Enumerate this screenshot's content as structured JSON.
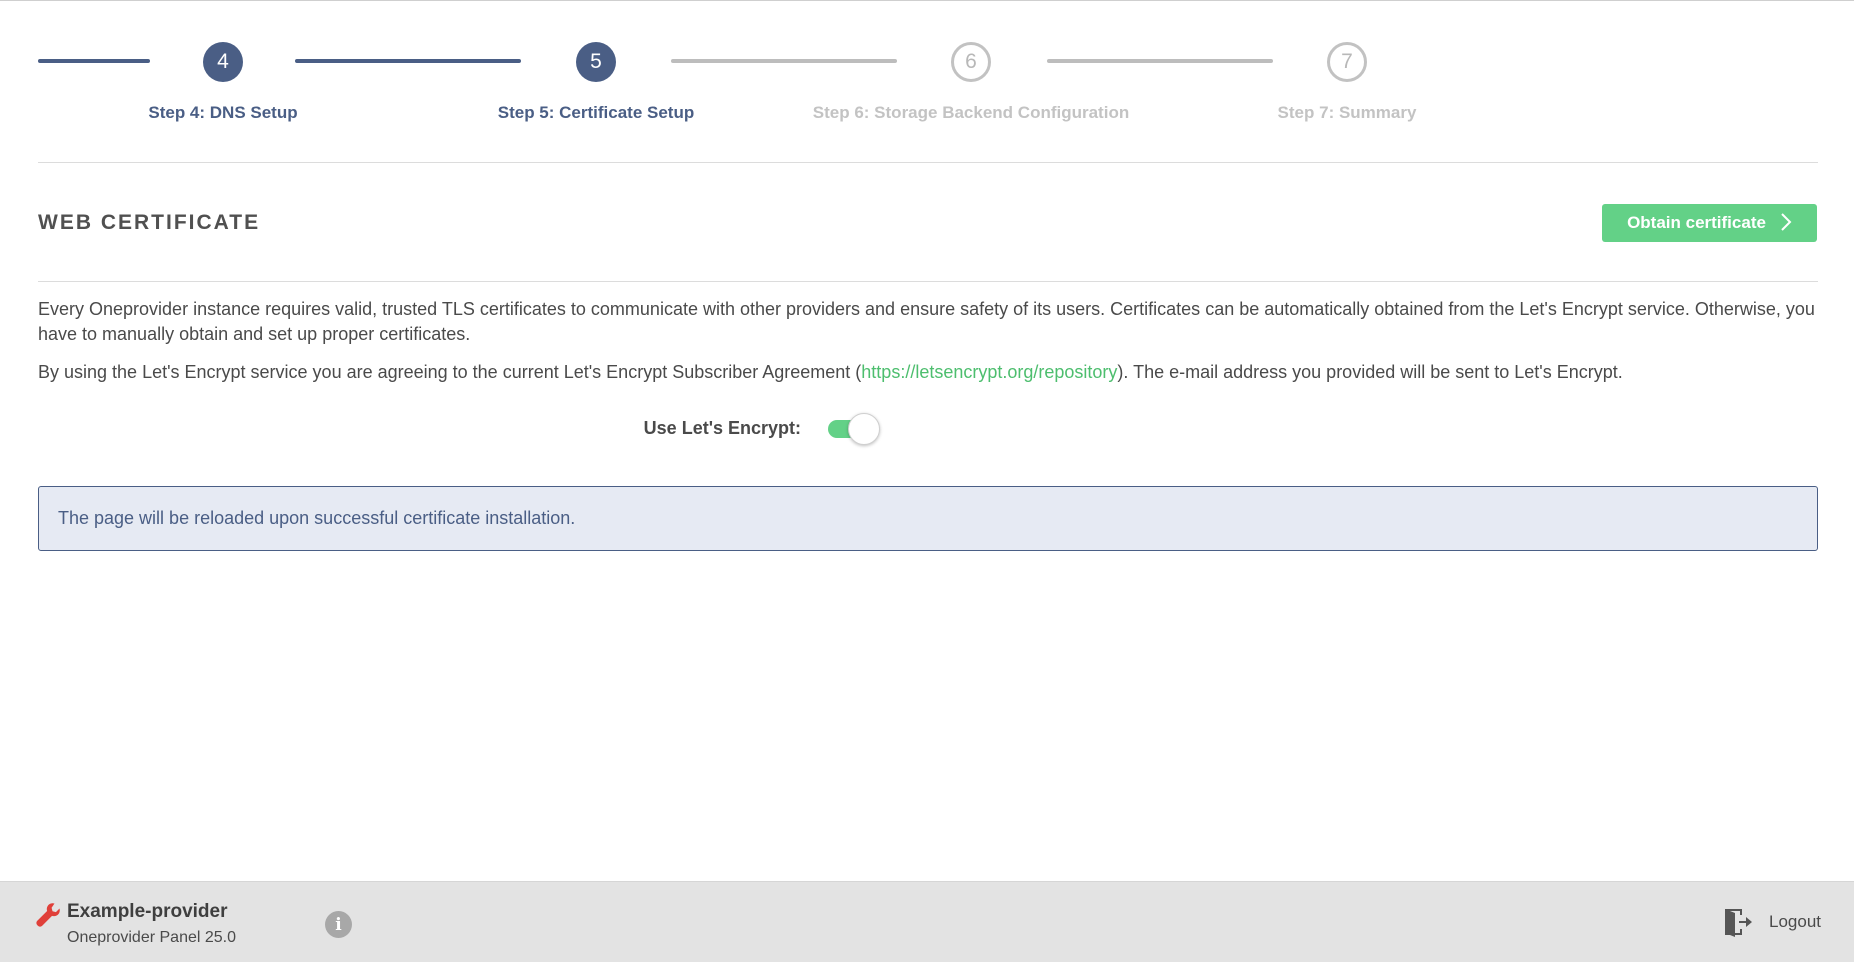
{
  "stepper": {
    "steps": [
      {
        "number": "4",
        "label": "Step 4: DNS Setup",
        "state": "done"
      },
      {
        "number": "5",
        "label": "Step 5: Certificate Setup",
        "state": "current"
      },
      {
        "number": "6",
        "label": "Step 6: Storage Backend Configuration",
        "state": "todo"
      },
      {
        "number": "7",
        "label": "Step 7: Summary",
        "state": "todo"
      }
    ]
  },
  "section": {
    "title": "WEB CERTIFICATE",
    "obtain_button": "Obtain certificate"
  },
  "content": {
    "description": "Every Oneprovider instance requires valid, trusted TLS certificates to communicate with other providers and ensure safety of its users. Certificates can be automatically obtained from the Let's Encrypt service. Otherwise, you have to manually obtain and set up proper certificates.",
    "agreement_before": "By using the Let's Encrypt service you are agreeing to the current Let's Encrypt Subscriber Agreement (",
    "agreement_link": "https://letsencrypt.org/repository",
    "agreement_after": "). The e-mail address you provided will be sent to Let's Encrypt.",
    "toggle_label": "Use Let's Encrypt:",
    "toggle_on": true,
    "info_message": "The page will be reloaded upon successful certificate installation."
  },
  "footer": {
    "provider_name": "Example-provider",
    "panel_version": "Oneprovider Panel 25.0",
    "info_icon_glyph": "i",
    "logout_label": "Logout"
  },
  "colors": {
    "accent_navy": "#4a5e85",
    "accent_green": "#63d187",
    "link_green": "#4dbe6e",
    "wrench_red": "#e0403a"
  },
  "icons": {
    "provider": "wrench-icon",
    "info": "info-icon",
    "logout": "logout-icon",
    "obtain_button": "chevron-right-icon"
  }
}
